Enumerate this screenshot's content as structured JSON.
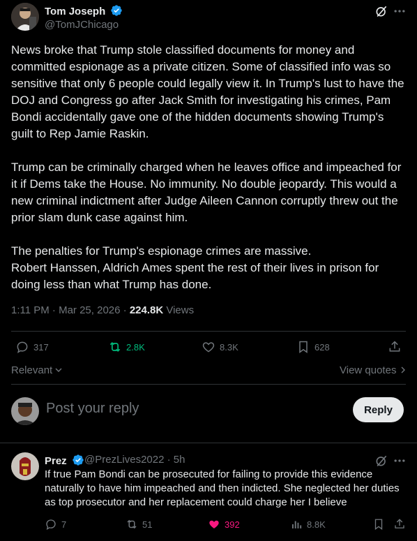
{
  "post": {
    "author_name": "Tom Joseph",
    "author_handle": "@TomJChicago",
    "paragraphs": [
      "News broke that Trump stole classified documents for money and committed espionage as a private citizen. Some of classified info was so sensitive that only 6 people could legally view it. In Trump's lust to have the DOJ and Congress go after Jack Smith for investigating his crimes, Pam Bondi accidentally gave one of the hidden documents showing Trump's guilt to Rep Jamie Raskin.",
      "Trump can be criminally charged when he leaves office and impeached for it if Dems take the House. No immunity. No double jeopardy. This would a new criminal indictment after Judge Aileen Cannon corruptly threw out the prior slam dunk case against him.",
      "The penalties for Trump's espionage crimes are massive.\nRobert Hanssen, Aldrich Ames spent the rest of their lives in prison for doing less than what Trump has done."
    ],
    "timestamp": "1:11 PM · Mar 25, 2026 · ",
    "views_count": "224.8K",
    "views_label": " Views",
    "stats": {
      "replies": "317",
      "reposts": "2.8K",
      "likes": "8.3K",
      "bookmarks": "628"
    }
  },
  "filters": {
    "sort_label": "Relevant",
    "view_quotes_label": "View quotes"
  },
  "composer": {
    "placeholder": "Post your reply",
    "button_label": "Reply"
  },
  "reply": {
    "author_name": "Prez",
    "author_handle": "@PrezLives2022 · 5h",
    "text": "If true Pam Bondi can be prosecuted for failing to provide this evidence naturally to have him impeached and then indicted. She neglected her duties as top prosecutor and her replacement could charge her I believe",
    "stats": {
      "replies": "7",
      "reposts": "51",
      "likes": "392",
      "views": "8.8K"
    }
  },
  "colors": {
    "background": "#000000",
    "verified_blue": "#1d9bf0",
    "repost_green": "#00ba7c",
    "like_pink": "#f91880",
    "muted": "#71767b"
  },
  "icons": [
    "grok-icon",
    "more-icon",
    "verified-icon",
    "reply-icon",
    "repost-icon",
    "like-icon",
    "bookmark-icon",
    "share-icon",
    "views-icon",
    "chevron-down-icon",
    "chevron-right-icon"
  ]
}
